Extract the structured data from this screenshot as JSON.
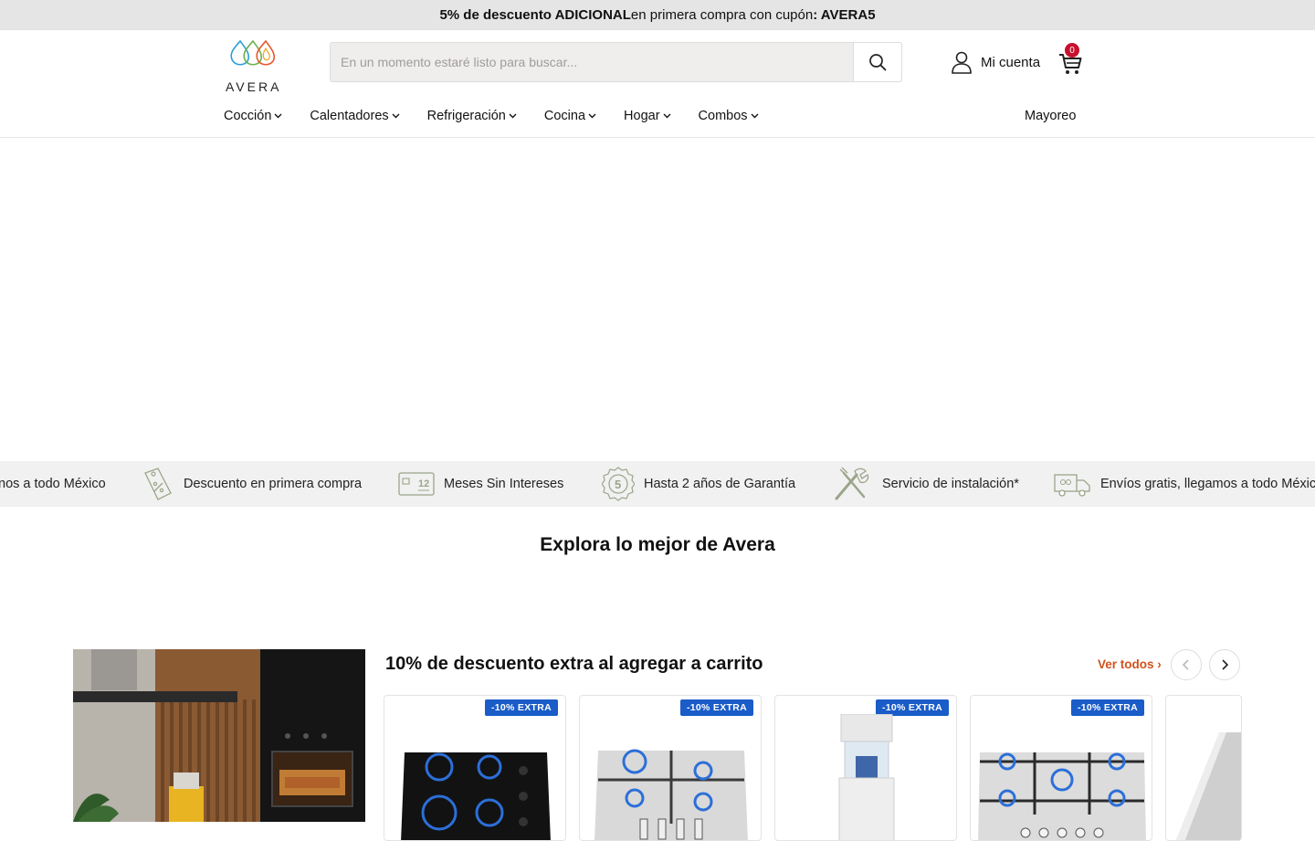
{
  "promo_bar": {
    "part1": "5% de descuento ADICIONAL",
    "part2": " en primera compra con cupón",
    "part3": ": AVERA5"
  },
  "header": {
    "logo_text": "AVERA",
    "search_placeholder": "En un momento estaré listo para buscar...",
    "account_label": "Mi cuenta",
    "cart_count": "0"
  },
  "nav": {
    "items": [
      "Cocción",
      "Calentadores",
      "Refrigeración",
      "Cocina",
      "Hogar",
      "Combos"
    ],
    "mayoreo": "Mayoreo"
  },
  "benefits": [
    "nos a todo México",
    "Descuento en primera compra",
    "Meses Sin Intereses",
    "Hasta 2 años de Garantía",
    "Servicio de instalación*",
    "Envíos gratis, llegamos a todo México"
  ],
  "section_title": "Explora lo mejor de Avera",
  "product_row": {
    "title": "10% de descuento extra al agregar a carrito",
    "ver_todos": "Ver todos ›",
    "badge": "-10% EXTRA",
    "products": [
      {
        "icon": "black-gas-cooktop-image"
      },
      {
        "icon": "steel-gas-cooktop-image"
      },
      {
        "icon": "water-filter-image"
      },
      {
        "icon": "steel-gas-cooktop-5-burner-image"
      },
      {
        "icon": "range-hood-image"
      }
    ]
  },
  "colors": {
    "accent": "#d0511b",
    "badge": "#1a5cc8",
    "cart_badge": "#c8102e"
  }
}
